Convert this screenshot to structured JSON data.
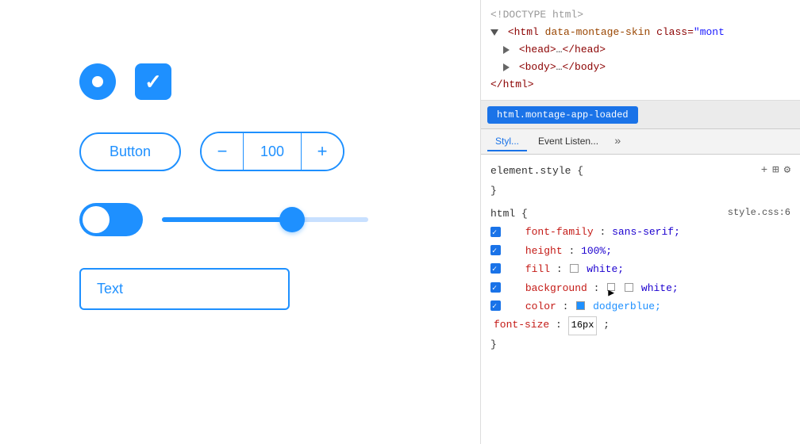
{
  "left": {
    "radio_label": "radio button",
    "checkbox_label": "checkbox",
    "button_label": "Button",
    "stepper_value": "100",
    "stepper_minus": "−",
    "stepper_plus": "+",
    "text_input_value": "Text",
    "slider_percent": 63
  },
  "right": {
    "html_source": [
      {
        "type": "comment",
        "text": "<!DOCTYPE html>"
      },
      {
        "type": "open-selected",
        "tag": "html",
        "attr_name": "data-montage-skin",
        "attr_value": "class=\"mont"
      },
      {
        "type": "child",
        "text": "<head>…</head>"
      },
      {
        "type": "child",
        "text": "<body>…</body>"
      },
      {
        "type": "close",
        "tag": "/html"
      }
    ],
    "selected_element_label": "html.montage-app-loaded",
    "tabs": [
      "Styl...",
      "Event Listen...",
      "»"
    ],
    "active_tab": "Styl...",
    "element_style_label": "element.style {",
    "element_style_close": "}",
    "style_source": "style.css:6",
    "html_rule_selector": "html {",
    "html_rule_close": "}",
    "properties": [
      {
        "name": "font-family",
        "colon": ":",
        "value": "sans-serif;"
      },
      {
        "name": "height",
        "colon": ":",
        "value": "100%;"
      },
      {
        "name": "fill",
        "colon": ":",
        "value": "white;",
        "has_swatch": true,
        "swatch_color": "white"
      },
      {
        "name": "background",
        "colon": ":",
        "value": "white;",
        "has_swatch": true,
        "swatch_color": "white"
      },
      {
        "name": "color",
        "colon": ":",
        "value": "dodgerblue;",
        "has_swatch": true,
        "swatch_color": "blue"
      },
      {
        "name": "font-size",
        "colon": ":",
        "value": "16px",
        "has_input": true
      }
    ]
  }
}
